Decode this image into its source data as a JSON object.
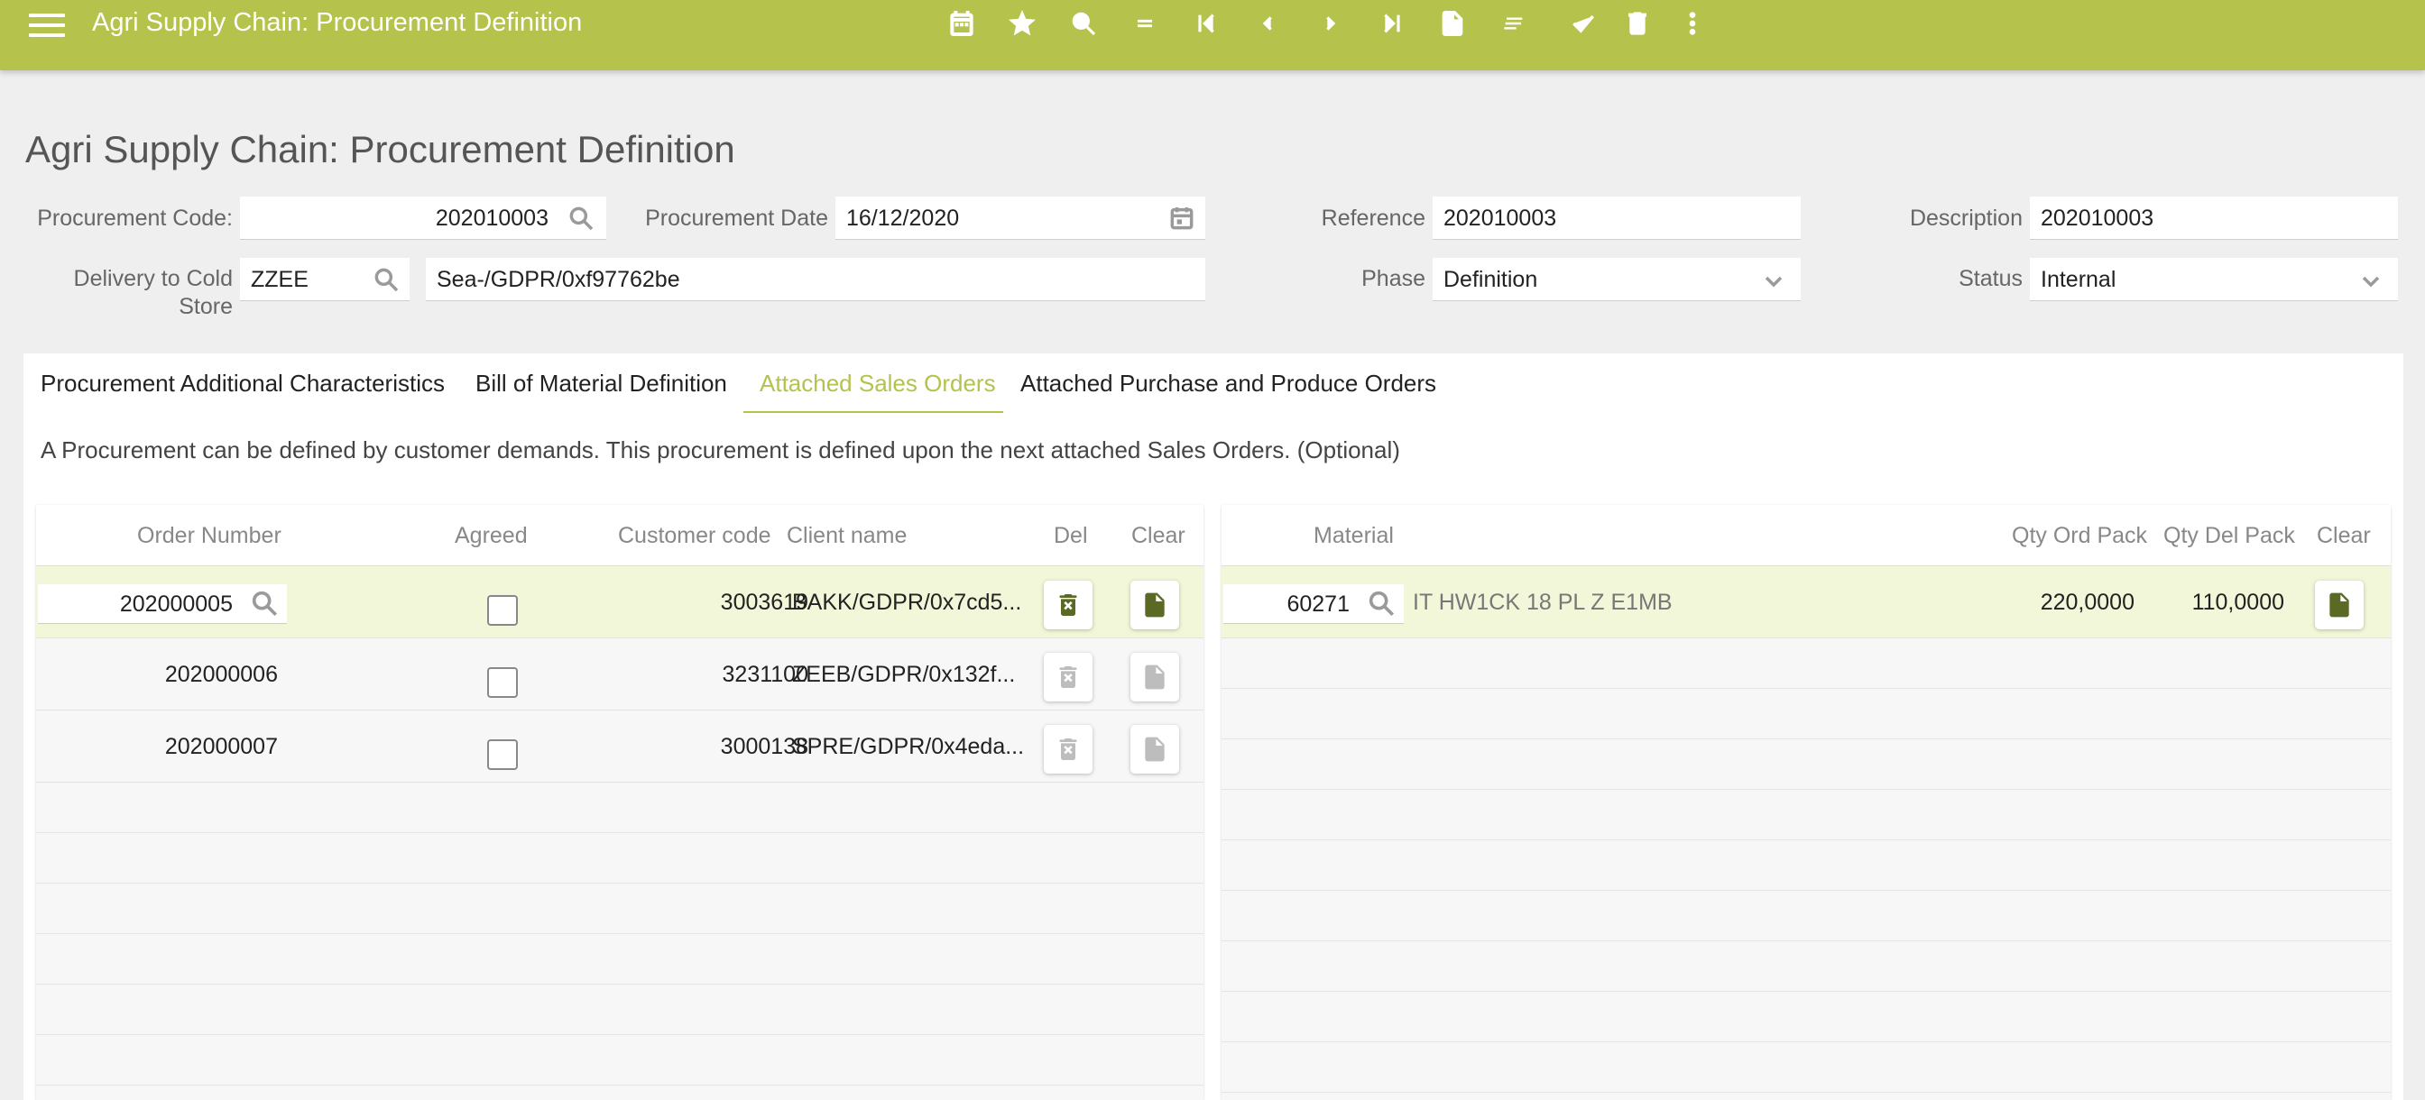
{
  "app": {
    "title": "Agri Supply Chain: Procurement Definition"
  },
  "toolbar": {
    "icons": [
      "calendar-icon",
      "star-icon",
      "search-icon",
      "equals-icon",
      "first-record-icon",
      "previous-record-icon",
      "next-record-icon",
      "last-record-icon",
      "new-document-icon",
      "notes-icon",
      "check-icon",
      "delete-icon",
      "more-vert-icon"
    ]
  },
  "page": {
    "title": "Agri Supply Chain: Procurement Definition"
  },
  "form": {
    "procurement_code_label": "Procurement Code:",
    "procurement_code": "202010003",
    "procurement_date_label": "Procurement Date",
    "procurement_date": "16/12/2020",
    "reference_label": "Reference",
    "reference": "202010003",
    "description_label": "Description",
    "description": "202010003",
    "delivery_label": "Delivery to Cold Store",
    "delivery_code": "ZZEE",
    "delivery_name": "Sea-/GDPR/0xf97762be",
    "phase_label": "Phase",
    "phase": "Definition",
    "status_label": "Status",
    "status": "Internal"
  },
  "tabs": [
    {
      "label": "Procurement Additional Characteristics"
    },
    {
      "label": "Bill of Material Definition"
    },
    {
      "label": "Attached Sales Orders"
    },
    {
      "label": "Attached Purchase and Produce Orders"
    }
  ],
  "hint": "A Procurement can be defined by customer demands. This procurement is defined upon the next attached Sales Orders. (Optional)",
  "sales_grid": {
    "headers": {
      "order_number": "Order Number",
      "agreed": "Agreed",
      "customer_code": "Customer code",
      "client_name": "Client name",
      "del": "Del",
      "clear": "Clear"
    },
    "rows": [
      {
        "order_number": "202000005",
        "customer_code": "3003619",
        "client_name": "BAKK/GDPR/0x7cd5...",
        "agreed": false
      },
      {
        "order_number": "202000006",
        "customer_code": "3231100",
        "client_name": "ZEEB/GDPR/0x132f...",
        "agreed": false
      },
      {
        "order_number": "202000007",
        "customer_code": "3000138",
        "client_name": "SPRE/GDPR/0x4eda...",
        "agreed": false
      }
    ]
  },
  "material_grid": {
    "headers": {
      "material": "Material",
      "qty_ord_pack": "Qty Ord Pack",
      "qty_del_pack": "Qty Del Pack",
      "clear": "Clear"
    },
    "rows": [
      {
        "material": "60271",
        "description": "IT HW1CK 18 PL Z E1MB",
        "qty_ord_pack": "220,0000",
        "qty_del_pack": "110,0000"
      }
    ]
  },
  "colors": {
    "accent": "#b5c24b",
    "selected_row": "#f3f7d9",
    "icon_active": "#5a6a24"
  }
}
